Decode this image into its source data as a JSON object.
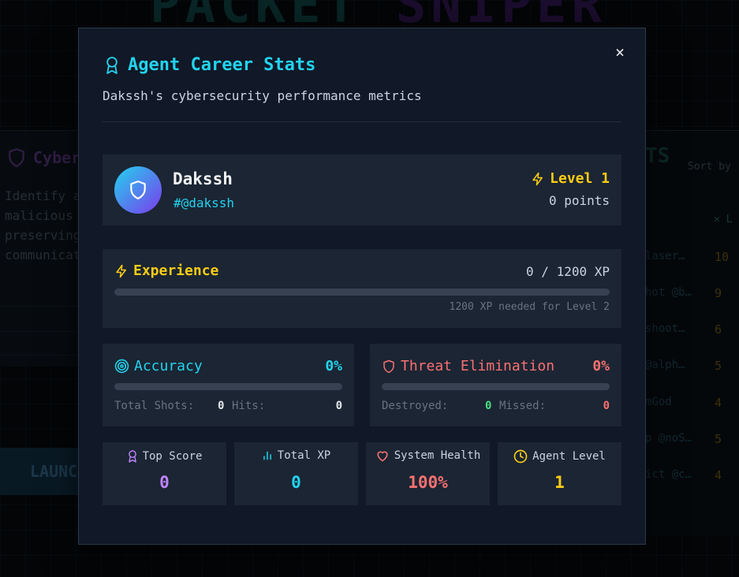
{
  "background": {
    "title_a": "PACKET",
    "title_b": "SNIPER",
    "left_heading": "Cyber",
    "left_lines": [
      "Identify a",
      "malicious",
      "preserving",
      "communicat"
    ],
    "launch_label": "LAUNC",
    "right_heading": "TS",
    "sort_label": "Sort by",
    "level_col": "L",
    "entries": [
      {
        "name": "laser…",
        "score": "10"
      },
      {
        "name": "hot @b…",
        "score": "9"
      },
      {
        "name": "shoot…",
        "score": "6"
      },
      {
        "name": "@alph…",
        "score": "5"
      },
      {
        "name": "mGod",
        "score": "4"
      },
      {
        "name": "p @noS…",
        "score": "5"
      },
      {
        "name": "ict @c…",
        "score": "4"
      }
    ]
  },
  "modal": {
    "title": "Agent Career Stats",
    "subtitle": "Dakssh's cybersecurity performance metrics",
    "close_label": "×",
    "profile": {
      "name": "Dakssh",
      "handle": "#@dakssh",
      "level_label": "Level 1",
      "points_label": "0 points"
    },
    "experience": {
      "label": "Experience",
      "value_label": "0 / 1200 XP",
      "progress": 0,
      "needed_label": "1200 XP needed for Level 2"
    },
    "accuracy": {
      "label": "Accuracy",
      "percent": "0%",
      "progress": 0,
      "total_shots_label": "Total Shots:",
      "total_shots": "0",
      "hits_label": "Hits:",
      "hits": "0"
    },
    "threat": {
      "label": "Threat Elimination",
      "percent": "0%",
      "progress": 0,
      "destroyed_label": "Destroyed:",
      "destroyed": "0",
      "missed_label": "Missed:",
      "missed": "0"
    },
    "tiles": {
      "top_score": {
        "label": "Top Score",
        "value": "0"
      },
      "total_xp": {
        "label": "Total XP",
        "value": "0"
      },
      "system_health": {
        "label": "System Health",
        "value": "100%"
      },
      "agent_level": {
        "label": "Agent Level",
        "value": "1"
      }
    }
  },
  "colors": {
    "accent_cyan": "#22d3ee",
    "accent_yellow": "#facc15",
    "accent_red": "#f87171",
    "accent_purple": "#c084fc",
    "accent_green": "#4ade80"
  }
}
